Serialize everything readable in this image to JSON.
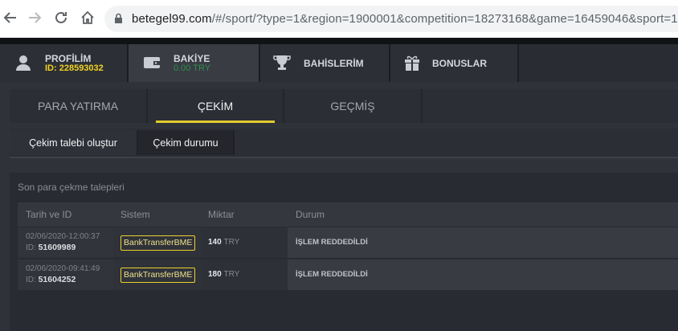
{
  "browser": {
    "url_host": "betegel99.com",
    "url_path": "/#/sport/?type=1&region=1900001&competition=18273168&game=16459046&sport=1"
  },
  "main_tabs": {
    "profile": {
      "label": "PROFİLİM",
      "sub": "ID: 228593032"
    },
    "balance": {
      "label": "BAKİYE",
      "sub": "0.00 TRY"
    },
    "bets": {
      "label": "BAHİSLERİM"
    },
    "bonuses": {
      "label": "BONUSLAR"
    }
  },
  "sub_tabs": [
    "PARA YATIRMA",
    "ÇEKİM",
    "GEÇMİŞ"
  ],
  "pills": [
    "Çekim talebi oluştur",
    "Çekim durumu"
  ],
  "list": {
    "title": "Son para çekme talepleri",
    "headers": [
      "Tarih ve ID",
      "Sistem",
      "Miktar",
      "Durum"
    ],
    "rows": [
      {
        "date": "02/06/2020-12:00:37",
        "id_prefix": "ID:",
        "id": "51609989",
        "system": "BankTransferBME",
        "amount": "140",
        "currency": "TRY",
        "status": "İŞLEM REDDEDİLDİ"
      },
      {
        "date": "02/06/2020-09:41:49",
        "id_prefix": "ID:",
        "id": "51604252",
        "system": "BankTransferBME",
        "amount": "180",
        "currency": "TRY",
        "status": "İŞLEM REDDEDİLDİ"
      }
    ]
  },
  "colors": {
    "accent": "#e1cc2b",
    "balance": "#2f8f4f",
    "id": "#f0d323"
  }
}
